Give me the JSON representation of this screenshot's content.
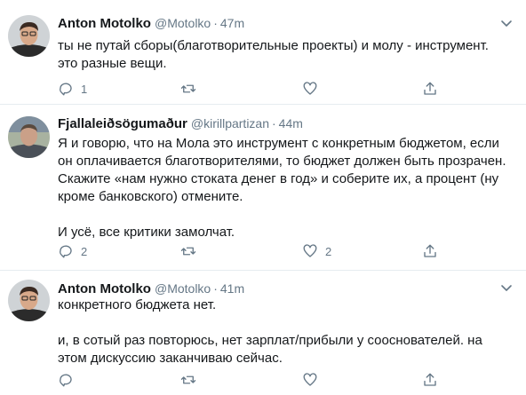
{
  "tweets": [
    {
      "name": "Anton Motolko",
      "handle": "@Motolko",
      "separator": "·",
      "time": "47m",
      "paragraphs": [
        "ты не путай сборы(благотворительные проекты) и молу - инструмент. это разные вещи."
      ],
      "reply_count": "1",
      "retweet_count": "",
      "like_count": ""
    },
    {
      "name": "Fjallaleiðsögumaður",
      "handle": "@kirillpartizan",
      "separator": "·",
      "time": "44m",
      "paragraphs": [
        "Я и говорю, что на Мола это инструмент с конкретным бюджетом, если он оплачивается благотворителями, то бюджет должен быть прозрачен. Скажите «нам нужно стоката денег в год» и соберите их, а процент (ну кроме банковского) отмените.",
        "И усё, все критики замолчат."
      ],
      "reply_count": "2",
      "retweet_count": "",
      "like_count": "2"
    },
    {
      "name": "Anton Motolko",
      "handle": "@Motolko",
      "separator": "·",
      "time": "41m",
      "paragraphs": [
        "конкретного бюджета нет.",
        "и, в сотый раз повторюсь, нет зарплат/прибыли у сооснователей. на этом дискуссию заканчиваю сейчас."
      ],
      "reply_count": "",
      "retweet_count": "",
      "like_count": ""
    }
  ],
  "icons": {
    "more": "chevron-down-icon",
    "reply": "reply-icon",
    "retweet": "retweet-icon",
    "like": "like-icon",
    "share": "share-icon"
  },
  "colors": {
    "text": "#14171a",
    "secondary": "#657786",
    "divider": "#e6ecf0"
  }
}
